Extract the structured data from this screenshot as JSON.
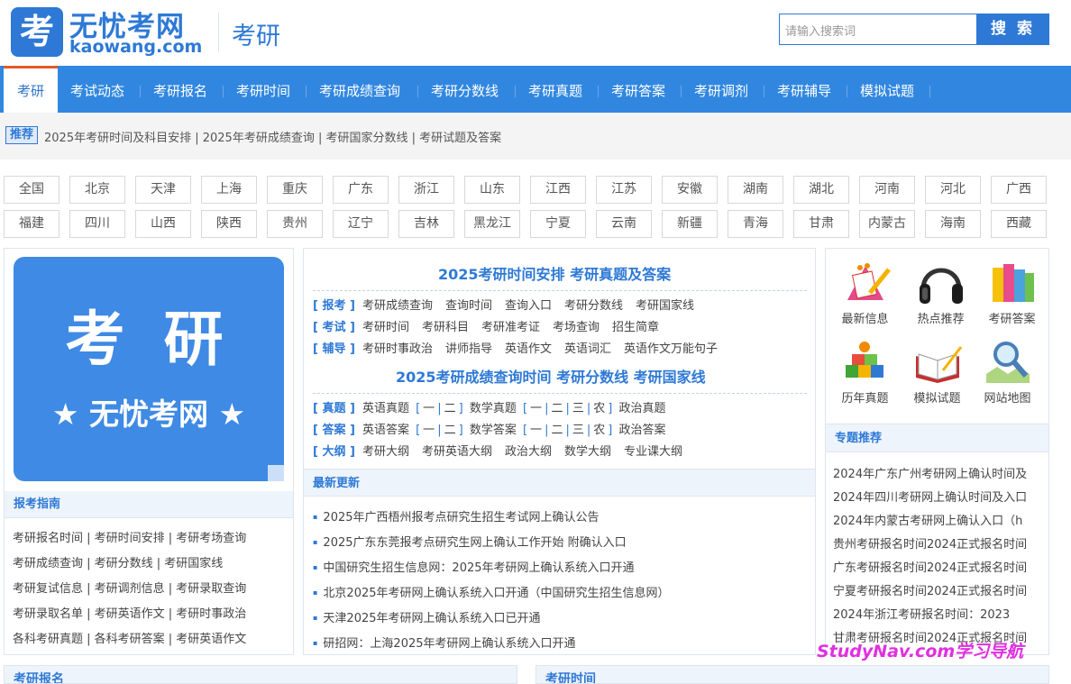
{
  "header": {
    "logo_char": "考",
    "site_name": "无忧考网",
    "site_url": "kaowang.com",
    "category": "考研",
    "search_placeholder": "请输入搜索词",
    "search_button": "搜 索"
  },
  "nav": [
    "考研",
    "考试动态",
    "考研报名",
    "考研时间",
    "考研成绩查询",
    "考研分数线",
    "考研真题",
    "考研答案",
    "考研调剂",
    "考研辅导",
    "模拟试题"
  ],
  "recommend": {
    "tag": "推荐",
    "links": "2025年考研时间及科目安排 | 2025年考研成绩查询 | 考研国家分数线 | 考研试题及答案"
  },
  "provinces": [
    "全国",
    "北京",
    "天津",
    "上海",
    "重庆",
    "广东",
    "浙江",
    "山东",
    "江西",
    "江苏",
    "安徽",
    "湖南",
    "湖北",
    "河南",
    "河北",
    "广西",
    "福建",
    "四川",
    "山西",
    "陕西",
    "贵州",
    "辽宁",
    "吉林",
    "黑龙江",
    "宁夏",
    "云南",
    "新疆",
    "青海",
    "甘肃",
    "内蒙古",
    "海南",
    "西藏"
  ],
  "big_logo": {
    "line1": "考 研",
    "line2": "★ 无忧考网 ★"
  },
  "guide": {
    "title": "报考指南",
    "rows": [
      "考研报名时间 | 考研时间安排 | 考研考场查询",
      "考研成绩查询 |  考研分数线 | 考研国家线",
      "考研复试信息 | 考研调剂信息 | 考研录取查询",
      "考研录取名单 | 考研英语作文 | 考研时事政治",
      "各科考研真题 | 各科考研答案 | 考研英语作文"
    ]
  },
  "mid": {
    "title1": "2025考研时间安排   考研真题及答案",
    "rows1": [
      {
        "tag": "[ 报考 ]",
        "links": [
          "考研成绩查询",
          "查询时间",
          "查询入口",
          "考研分数线",
          "考研国家线"
        ]
      },
      {
        "tag": "[ 考试 ]",
        "links": [
          "考研时间",
          "考研科目",
          "考研准考证",
          "考场查询",
          "招生简章"
        ]
      },
      {
        "tag": "[ 辅导 ]",
        "links": [
          "考研时事政治",
          "讲师指导",
          "英语作文",
          "英语词汇",
          "英语作文万能句子"
        ]
      }
    ],
    "title2": "2025考研成绩查询时间   考研分数线   考研国家线",
    "zhenti": {
      "tag": "[ 真题 ]",
      "a": "英语真题",
      "b": "数学真题",
      "c": "政治真题"
    },
    "daan": {
      "tag": "[ 答案 ]",
      "a": "英语答案",
      "b": "数学答案",
      "c": "政治答案"
    },
    "brackets": {
      "yi": "一",
      "er": "二",
      "san": "三",
      "nong": "农",
      "open": "[",
      "close": "]",
      "sep": "|"
    },
    "dagang": {
      "tag": "[ 大纲 ]",
      "links": [
        "考研大纲",
        "考研英语大纲",
        "政治大纲",
        "数学大纲",
        "专业课大纲"
      ]
    }
  },
  "latest": {
    "title": "最新更新",
    "items": [
      "2025年广西梧州报考点研究生招生考试网上确认公告",
      "2025广东东莞报考点研究生网上确认工作开始 附确认入口",
      "中国研究生招生信息网：2025年考研网上确认系统入口开通",
      "北京2025年考研网上确认系统入口开通（中国研究生招生信息网）",
      "天津2025年考研网上确认系统入口已开通",
      "研招网：上海2025年考研网上确认系统入口开通"
    ]
  },
  "icons": [
    {
      "label": "最新信息",
      "icon": "notebook-pencil-icon"
    },
    {
      "label": "热点推荐",
      "icon": "headphones-icon"
    },
    {
      "label": "考研答案",
      "icon": "books-icon"
    },
    {
      "label": "历年真题",
      "icon": "blocks-icon"
    },
    {
      "label": "模拟试题",
      "icon": "open-book-icon"
    },
    {
      "label": "网站地图",
      "icon": "magnifier-icon"
    }
  ],
  "topics": {
    "title": "专题推荐",
    "items": [
      "2024年广东广州考研网上确认时间及",
      "2024年四川考研网上确认时间及入口",
      "2024年内蒙古考研网上确认入口（h",
      "贵州考研报名时间2024正式报名时间",
      "广东考研报名时间2024正式报名时间",
      "宁夏考研报名时间2024正式报名时间",
      "2024年浙江考研报名时间：2023",
      "甘肃考研报名时间2024正式报名时间"
    ]
  },
  "watermark": "StudyNav.com学习导航",
  "bottom": {
    "left": "考研报名",
    "right": "考研时间"
  },
  "colors": {
    "brand": "#2e79d6",
    "nav": "#3187e0",
    "active_border": "#e05a29",
    "watermark": "#e030e0"
  }
}
